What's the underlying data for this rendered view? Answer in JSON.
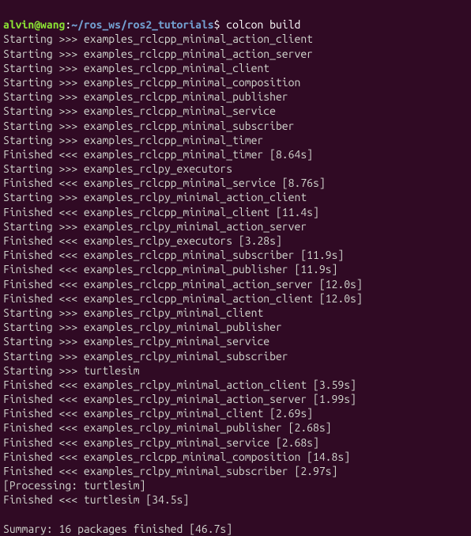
{
  "prompt": {
    "user": "alvin",
    "host": "wang",
    "path": "~/ros_ws/ros2_tutorials",
    "command": "colcon build"
  },
  "lines": [
    "Starting >>> examples_rclcpp_minimal_action_client",
    "Starting >>> examples_rclcpp_minimal_action_server",
    "Starting >>> examples_rclcpp_minimal_client",
    "Starting >>> examples_rclcpp_minimal_composition",
    "Starting >>> examples_rclcpp_minimal_publisher",
    "Starting >>> examples_rclcpp_minimal_service",
    "Starting >>> examples_rclcpp_minimal_subscriber",
    "Starting >>> examples_rclcpp_minimal_timer",
    "Finished <<< examples_rclcpp_minimal_timer [8.64s]",
    "Starting >>> examples_rclpy_executors",
    "Finished <<< examples_rclcpp_minimal_service [8.76s]",
    "Starting >>> examples_rclpy_minimal_action_client",
    "Finished <<< examples_rclcpp_minimal_client [11.4s]",
    "Starting >>> examples_rclpy_minimal_action_server",
    "Finished <<< examples_rclpy_executors [3.28s]",
    "Finished <<< examples_rclcpp_minimal_subscriber [11.9s]",
    "Finished <<< examples_rclcpp_minimal_publisher [11.9s]",
    "Finished <<< examples_rclcpp_minimal_action_server [12.0s]",
    "Finished <<< examples_rclcpp_minimal_action_client [12.0s]",
    "Starting >>> examples_rclpy_minimal_client",
    "Starting >>> examples_rclpy_minimal_publisher",
    "Starting >>> examples_rclpy_minimal_service",
    "Starting >>> examples_rclpy_minimal_subscriber",
    "Starting >>> turtlesim",
    "Finished <<< examples_rclpy_minimal_action_client [3.59s]",
    "Finished <<< examples_rclpy_minimal_action_server [1.99s]",
    "Finished <<< examples_rclpy_minimal_client [2.69s]",
    "Finished <<< examples_rclpy_minimal_publisher [2.68s]",
    "Finished <<< examples_rclpy_minimal_service [2.68s]",
    "Finished <<< examples_rclcpp_minimal_composition [14.8s]",
    "Finished <<< examples_rclpy_minimal_subscriber [2.97s]",
    "[Processing: turtlesim]",
    "Finished <<< turtlesim [34.5s]",
    "",
    "Summary: 16 packages finished [46.7s]"
  ]
}
